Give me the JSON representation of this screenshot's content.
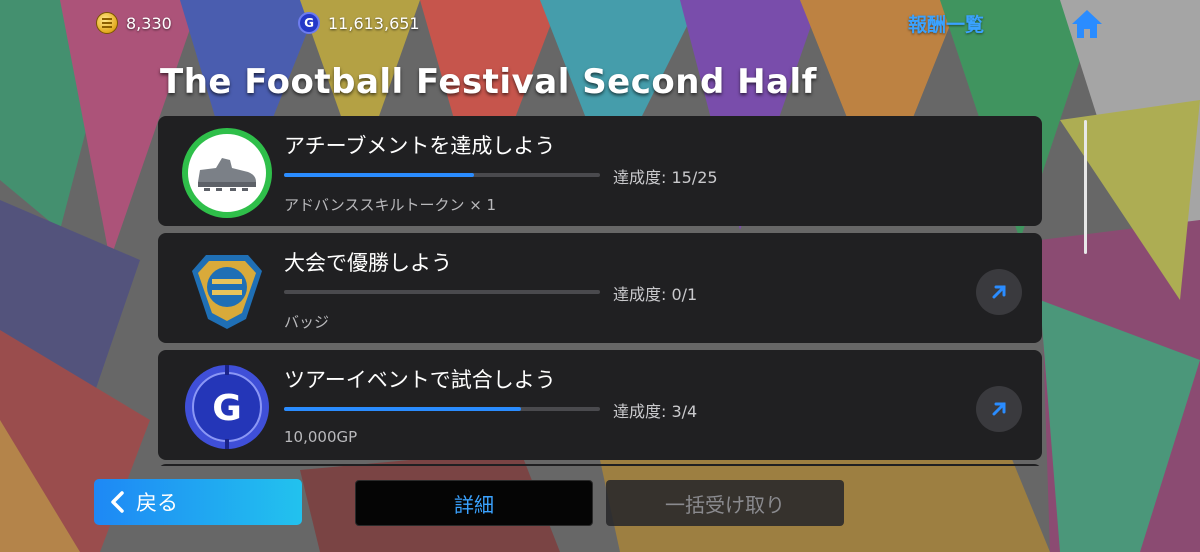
{
  "topbar": {
    "coins": "8,330",
    "gp": "11,613,651",
    "reward_list_label": "報酬一覧",
    "home_icon": "home-icon"
  },
  "title": "The Football Festival Second Half",
  "missions": [
    {
      "title": "アチーブメントを達成しよう",
      "progress_text": "達成度: 15/25",
      "progress": 0.6,
      "reward": "アドバンススキルトークン × 1",
      "icon": "boot-icon",
      "has_go_button": false
    },
    {
      "title": "大会で優勝しよう",
      "progress_text": "達成度: 0/1",
      "progress": 0,
      "reward": "バッジ",
      "icon": "badge-icon",
      "has_go_button": true
    },
    {
      "title": "ツアーイベントで試合しよう",
      "progress_text": "達成度: 3/4",
      "progress": 0.75,
      "reward": "10,000GP",
      "icon": "gp-coin-icon",
      "has_go_button": true
    }
  ],
  "buttons": {
    "back": "戻る",
    "details": "詳細",
    "claim_all": "一括受け取り"
  },
  "colors": {
    "accent": "#2a8cff",
    "link": "#3aa2ff",
    "card": "#202022"
  }
}
